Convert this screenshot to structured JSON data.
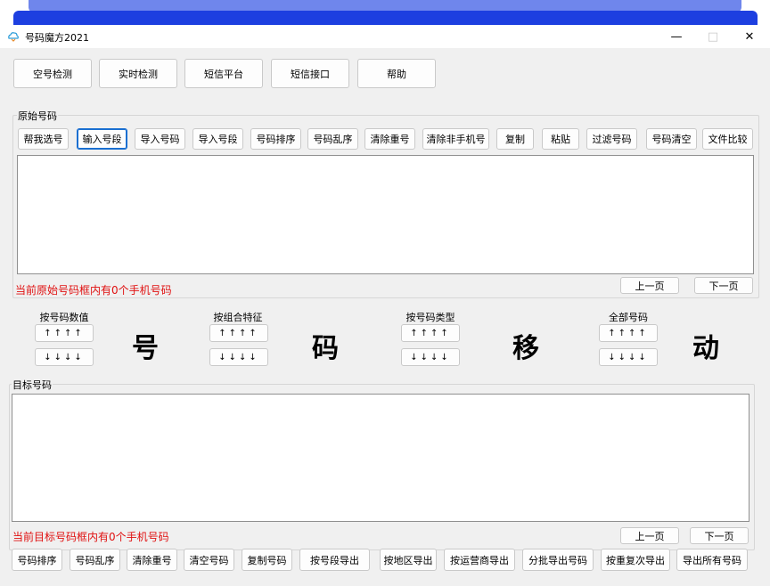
{
  "window": {
    "title": "号码魔方2021",
    "minimize": "—",
    "maximize": "□",
    "close": "✕"
  },
  "toolbar": [
    "空号检测",
    "实时检测",
    "短信平台",
    "短信接口",
    "帮助"
  ],
  "source_group": {
    "label": "原始号码",
    "buttons": [
      "帮我选号",
      "输入号段",
      "导入号码",
      "导入号段",
      "号码排序",
      "号码乱序",
      "清除重号",
      "清除非手机号",
      "复制",
      "粘贴",
      "过滤号码",
      "号码清空",
      "文件比较"
    ],
    "content": "",
    "status": "当前原始号码框内有0个手机号码",
    "prev_page": "上一页",
    "next_page": "下一页"
  },
  "sort": {
    "up_arrows": "↑↑↑↑",
    "down_arrows": "↓↓↓↓",
    "groups": [
      "按号码数值",
      "按组合特征",
      "按号码类型",
      "全部号码"
    ],
    "chars": [
      "号",
      "码",
      "移",
      "动"
    ]
  },
  "target_group": {
    "label": "目标号码",
    "content": "",
    "status": "当前目标号码框内有0个手机号码",
    "prev_page": "上一页",
    "next_page": "下一页",
    "buttons": [
      "号码排序",
      "号码乱序",
      "清除重号",
      "清空号码",
      "复制号码",
      "按号段导出",
      "按地区导出",
      "按运营商导出",
      "分批导出号码",
      "按重复次导出",
      "导出所有号码"
    ]
  },
  "colors": {
    "accent_blue": "#1a6fd1",
    "status_red": "#e01010",
    "deco_blue": "#1d3fe0"
  }
}
